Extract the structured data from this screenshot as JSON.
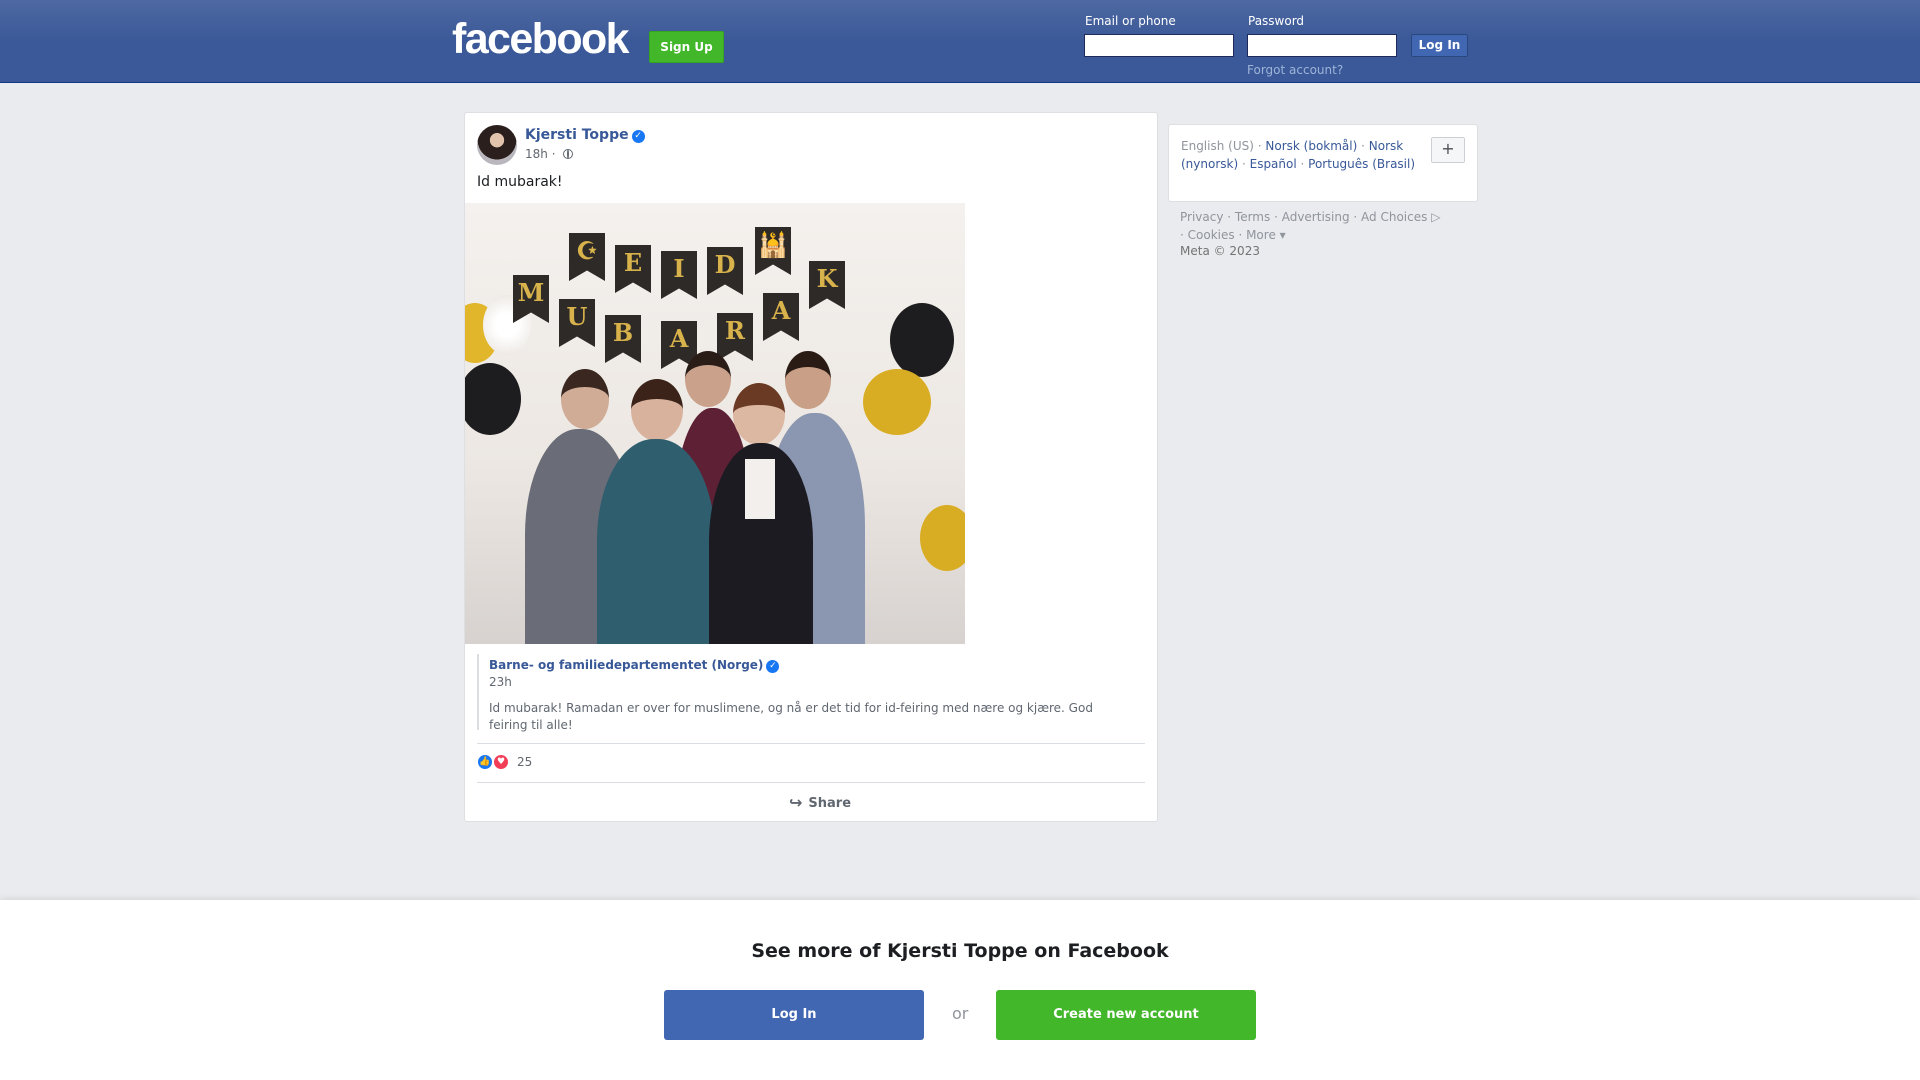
{
  "header": {
    "logo": "facebook",
    "signup_label": "Sign Up",
    "email_label": "Email or phone",
    "email_value": "",
    "password_label": "Password",
    "password_value": "",
    "login_label": "Log In",
    "forgot_label": "Forgot account?"
  },
  "post": {
    "author": "Kjersti Toppe",
    "time": "18h",
    "separator": "·",
    "text": "Id mubarak!",
    "photo": {
      "banner_line1": [
        "☪",
        "E",
        "I",
        "D",
        "🕌"
      ],
      "banner_line2": [
        "M",
        "U",
        "B",
        "A",
        "R",
        "A",
        "K"
      ]
    },
    "shared": {
      "author": "Barne- og familiedepartementet (Norge)",
      "time": "23h",
      "text": "Id mubarak! Ramadan er over for muslimene, og nå er det tid for id-feiring med nære og kjære. God feiring til alle!"
    },
    "reaction_count": "25",
    "share_label": "Share"
  },
  "sidebar": {
    "languages": {
      "current": "English (US)",
      "links": [
        "Norsk (bokmål)",
        "Norsk (nynorsk)",
        "Español",
        "Português (Brasil)"
      ],
      "more_button": "+"
    },
    "footer_links": [
      "Privacy",
      "Terms",
      "Advertising",
      "Ad Choices",
      "Cookies",
      "More"
    ],
    "copyright": "Meta © 2023"
  },
  "bottom_sheet": {
    "title": "See more of Kjersti Toppe on Facebook",
    "login_label": "Log In",
    "or_label": "or",
    "create_label": "Create new account"
  },
  "colors": {
    "brand_blue": "#4267b2",
    "header_blue": "#3b5998",
    "green": "#42b72a",
    "link_blue": "#385898",
    "background": "#e9ebee"
  }
}
